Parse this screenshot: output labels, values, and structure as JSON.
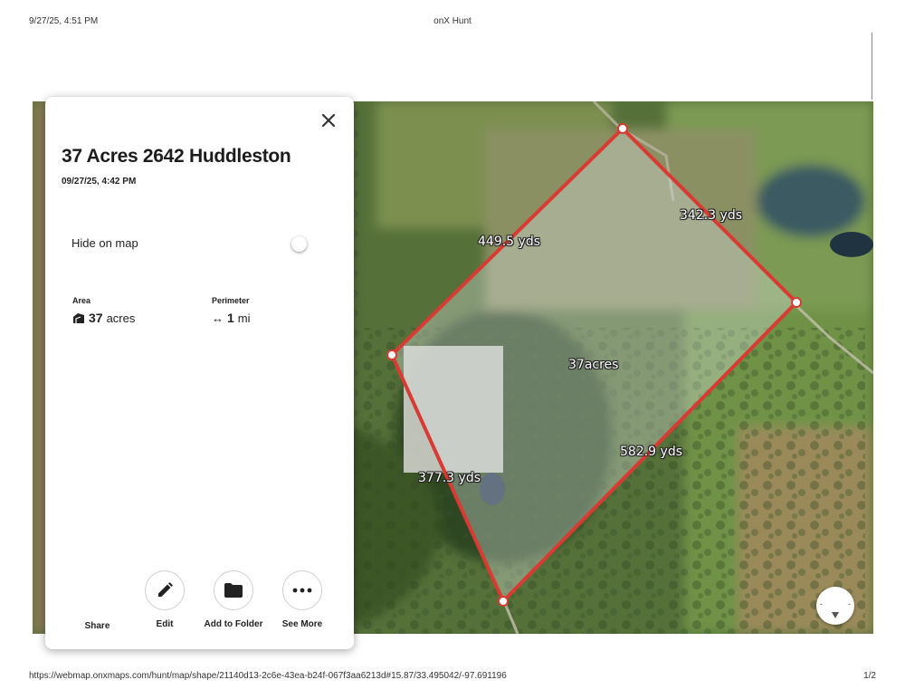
{
  "print_header": {
    "date": "9/27/25, 4:51 PM",
    "title": "onX Hunt"
  },
  "print_footer": {
    "url": "https://webmap.onxmaps.com/hunt/map/shape/21140d13-2c6e-43ea-b24f-067f3aa6213d#15.87/33.495042/-97.691196",
    "page": "1/2"
  },
  "panel": {
    "title": "37 Acres 2642 Huddleston",
    "date": "09/27/25, 4:42 PM",
    "hide_label": "Hide on map",
    "hide_on_map": false,
    "area": {
      "label": "Area",
      "value": "37",
      "unit": "acres",
      "icon": "area-icon"
    },
    "perimeter": {
      "label": "Perimeter",
      "value": "1",
      "unit": "mi",
      "icon": "↔"
    },
    "actions": [
      {
        "label": "Share",
        "icon": "share-icon"
      },
      {
        "label": "Edit",
        "icon": "pencil-icon"
      },
      {
        "label": "Add to Folder",
        "icon": "folder-icon"
      },
      {
        "label": "See More",
        "icon": "more-icon"
      }
    ]
  },
  "map": {
    "parcel_color": "#d93a32",
    "area_label": "37acres",
    "side_labels": {
      "north_west": "449.5 yds",
      "north_east": "342.3 yds",
      "south_east": "582.9 yds",
      "south_west": "377.3 yds"
    }
  }
}
